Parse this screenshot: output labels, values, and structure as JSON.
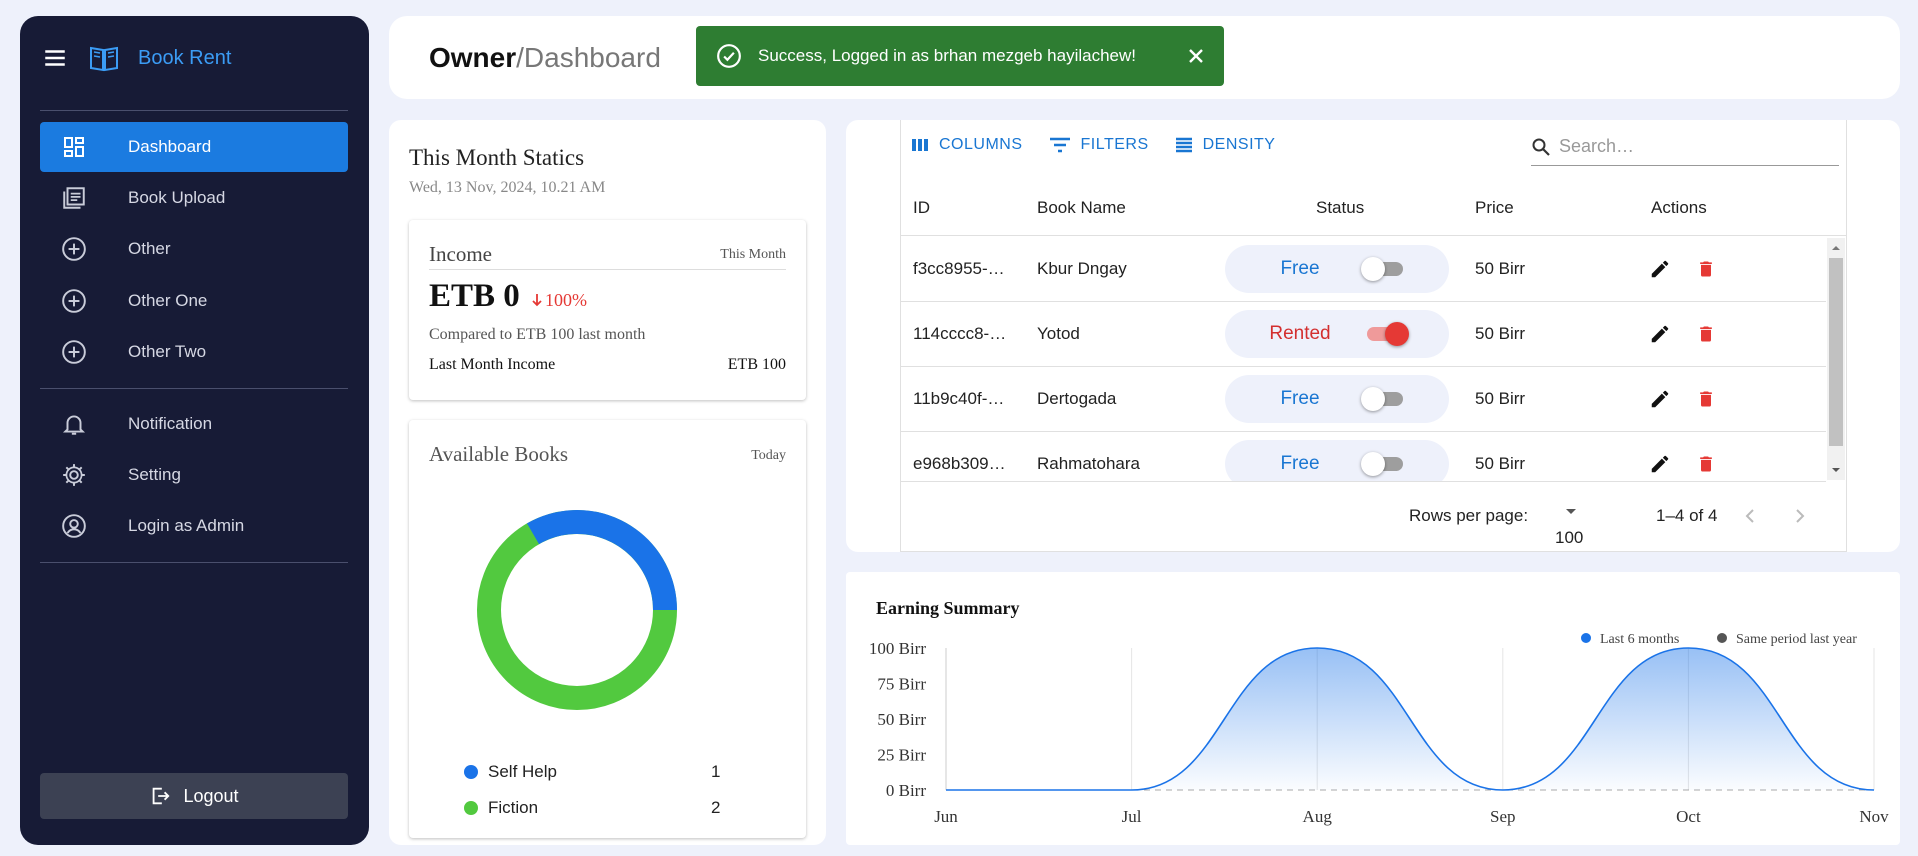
{
  "sidebar": {
    "brand": "Book Rent",
    "items": [
      {
        "label": "Dashboard",
        "icon": "dashboard-icon",
        "active": true
      },
      {
        "label": "Book Upload",
        "icon": "book-upload-icon"
      },
      {
        "label": "Other",
        "icon": "add-circle-icon"
      },
      {
        "label": "Other One",
        "icon": "add-circle-icon"
      },
      {
        "label": "Other Two",
        "icon": "add-circle-icon"
      }
    ],
    "secondary": [
      {
        "label": "Notification",
        "icon": "bell-icon"
      },
      {
        "label": "Setting",
        "icon": "gear-icon"
      },
      {
        "label": "Login as Admin",
        "icon": "user-circle-icon"
      }
    ],
    "logout": "Logout"
  },
  "header": {
    "role": "Owner",
    "sep": "/",
    "page": "Dashboard"
  },
  "toast": {
    "message": "Success, Logged in as brhan mezgeb hayilachew!"
  },
  "stats": {
    "title": "This Month Statics",
    "date": "Wed, 13 Nov, 2024, 10.21 AM",
    "income": {
      "label": "Income",
      "period": "This Month",
      "amount": "ETB 0",
      "change": "100%",
      "comparison": "Compared to ETB 100 last month",
      "last_label": "Last Month Income",
      "last_value": "ETB 100"
    },
    "available": {
      "label": "Available Books",
      "period": "Today",
      "categories": [
        {
          "name": "Self Help",
          "count": "1",
          "color": "#1a73e8"
        },
        {
          "name": "Fiction",
          "count": "2",
          "color": "#52c93f"
        }
      ]
    }
  },
  "table": {
    "toolbar": {
      "columns": "COLUMNS",
      "filters": "FILTERS",
      "density": "DENSITY",
      "search_placeholder": "Search…"
    },
    "headers": {
      "id": "ID",
      "name": "Book Name",
      "status": "Status",
      "price": "Price",
      "actions": "Actions"
    },
    "rows": [
      {
        "id": "f3cc8955-…",
        "name": "Kbur Dngay",
        "status": "Free",
        "on": false,
        "price": "50 Birr"
      },
      {
        "id": "114cccc8-…",
        "name": "Yotod",
        "status": "Rented",
        "on": true,
        "price": "50 Birr"
      },
      {
        "id": "11b9c40f-…",
        "name": "Dertogada",
        "status": "Free",
        "on": false,
        "price": "50 Birr"
      },
      {
        "id": "e968b309…",
        "name": "Rahmatohara",
        "status": "Free",
        "on": false,
        "price": "50 Birr"
      }
    ],
    "footer": {
      "rows_label": "Rows per page:",
      "rows_value": "100",
      "range": "1–4 of 4"
    }
  },
  "chart_data": {
    "type": "area",
    "title": "Earning Summary",
    "categories": [
      "Jun",
      "Jul",
      "Aug",
      "Sep",
      "Oct",
      "Nov"
    ],
    "y_ticks": [
      "0 Birr",
      "25 Birr",
      "50 Birr",
      "75 Birr",
      "100 Birr"
    ],
    "ylim": [
      0,
      100
    ],
    "series": [
      {
        "name": "Last 6 months",
        "values": [
          0,
          0,
          100,
          0,
          100,
          0
        ],
        "color": "#1a73e8"
      },
      {
        "name": "Same period last year",
        "values": [
          0,
          0,
          0,
          0,
          0,
          0
        ],
        "color": "#555555"
      }
    ],
    "legend": "top-right"
  }
}
